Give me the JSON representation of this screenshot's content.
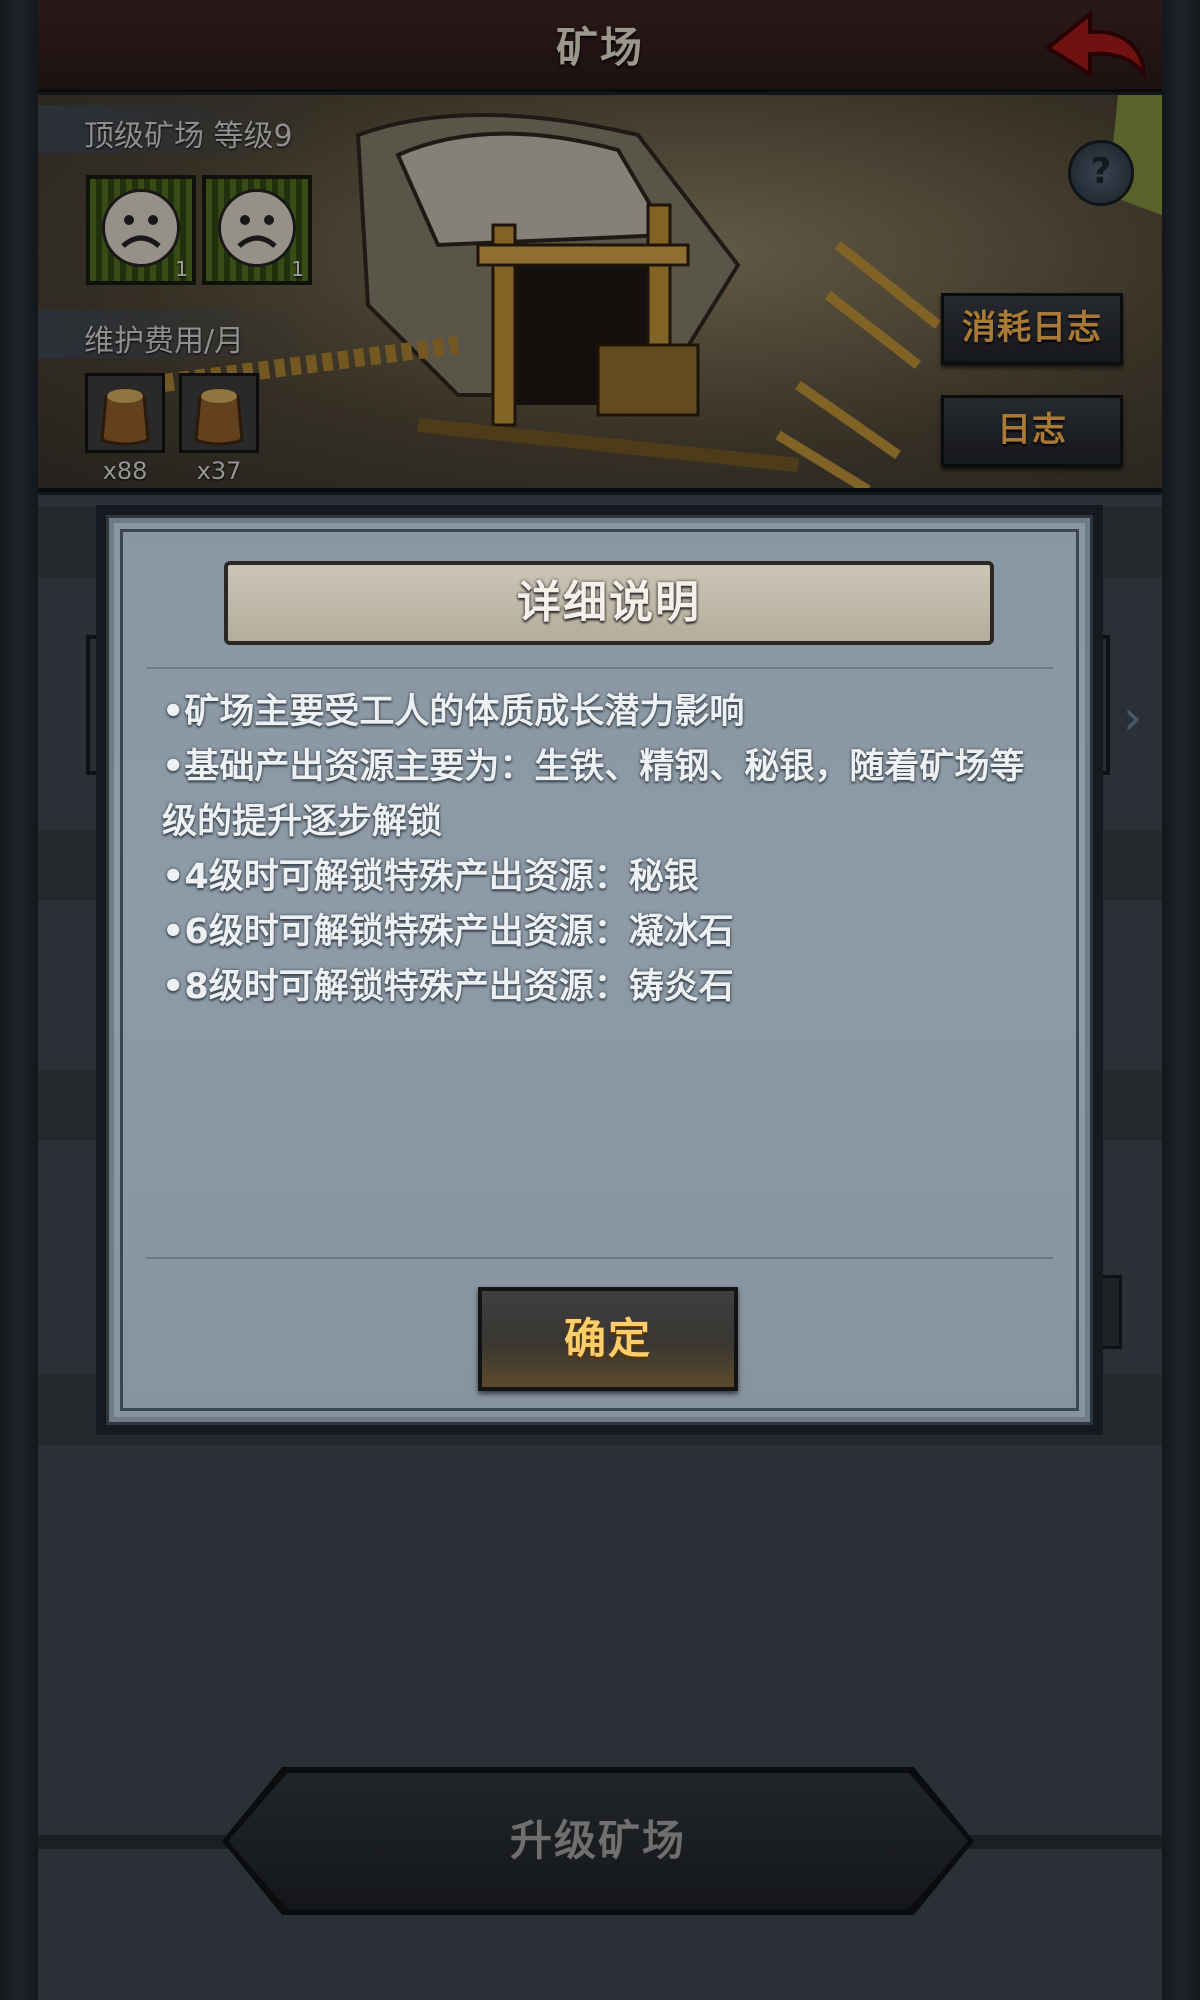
{
  "header": {
    "title": "矿场"
  },
  "scene": {
    "mine_label": "顶级矿场 等级9",
    "workers": [
      {
        "count": "1"
      },
      {
        "count": "1"
      }
    ],
    "upkeep_label": "维护费用/月",
    "upkeep_items": [
      {
        "qty": "x88"
      },
      {
        "qty": "x37"
      }
    ],
    "help_label": "?",
    "consume_log_label": "消耗日志",
    "log_label": "日志"
  },
  "background": {
    "upgrade_label": "升级矿场"
  },
  "modal": {
    "title": "详细说明",
    "lines": [
      "•矿场主要受工人的体质成长潜力影响",
      "•基础产出资源主要为：生铁、精钢、秘银，随着矿场等级的提升逐步解锁",
      "•4级时可解锁特殊产出资源：秘银",
      "•6级时可解锁特殊产出资源：凝冰石",
      "•8级时可解锁特殊产出资源：铸炎石"
    ],
    "confirm_label": "确定"
  },
  "colors": {
    "accent_orange": "#e9a94a",
    "confirm_text": "#ffce6a",
    "back_arrow": "#9c1a1a"
  }
}
